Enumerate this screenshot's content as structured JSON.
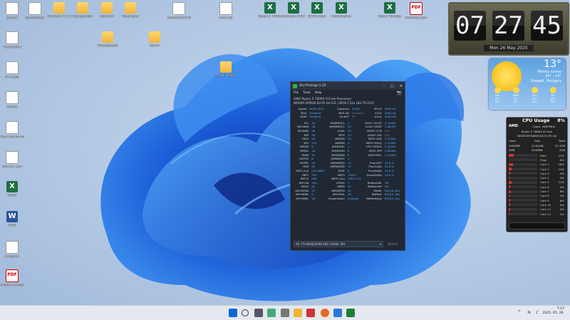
{
  "desktop_icons": [
    {
      "label": "Lomtár",
      "type": "txt"
    },
    {
      "label": "ZenTimings",
      "type": "txt"
    },
    {
      "label": "Windows 11 tweak fix",
      "type": "folder"
    },
    {
      "label": "Gyorsjavítás",
      "type": "folder"
    },
    {
      "label": "Macskák",
      "type": "folder"
    },
    {
      "label": "Fényképek",
      "type": "folder"
    },
    {
      "label": "XtremeShell DEP",
      "type": "txt"
    },
    {
      "label": "AMD.zip",
      "type": "txt"
    },
    {
      "label": "Ryzen 5 7600X",
      "type": "xls"
    },
    {
      "label": "Mérések 2025",
      "type": "xls"
    },
    {
      "label": "DDR5 teszt",
      "type": "xls"
    },
    {
      "label": "Hőmérséklet",
      "type": "xls"
    },
    {
      "label": "Ryzen Timings",
      "type": "xls"
    },
    {
      "label": "Kézikönyv.pdf",
      "type": "pdf"
    },
    {
      "label": "Fényképezés",
      "type": "folder"
    },
    {
      "label": "Zenék",
      "type": "folder"
    },
    {
      "label": "Asztal Mappa",
      "type": "folder"
    },
    {
      "label": "Vezérlőpult",
      "type": "txt"
    },
    {
      "label": "Ez a gép",
      "type": "txt"
    },
    {
      "label": "Firefox",
      "type": "txt"
    },
    {
      "label": "Total Commander",
      "type": "txt"
    },
    {
      "label": "MPC-HC x64",
      "type": "txt"
    },
    {
      "label": "Excel",
      "type": "xls"
    },
    {
      "label": "Word",
      "type": "docx"
    },
    {
      "label": "CCleaner",
      "type": "txt"
    },
    {
      "label": "Adobe Acrobat",
      "type": "pdf"
    }
  ],
  "zentimings": {
    "title": "ZenTimings 1.25",
    "menu": [
      "File",
      "Tools",
      "Help"
    ],
    "cpu_line1": "AMD Ryzen 5 7600X 6-Core Processor",
    "cpu_line2": "B650M AORUS ELITE AX ICE | BIOS F31a (84.79.225)",
    "top_rows": [
      [
        "Speed",
        "6000 MT/s",
        "Capacity",
        "32GB",
        "MCLK",
        "3000.00"
      ],
      [
        "BGS",
        "Enabled",
        "BGS Alt",
        "Disabled",
        "FCLK",
        "2000.00"
      ],
      [
        "GDM",
        "Enabled",
        "Cmd2T",
        "1T",
        "UCLK",
        "3000.00"
      ]
    ],
    "rows": [
      [
        "tCL",
        "30",
        "tRDRDSCL",
        "5",
        "VSOC (SVI3)",
        "1.2400V"
      ],
      [
        "tRCDWR",
        "36",
        "tWRWRSCL",
        "23",
        "CLDO VDDP",
        "1.0676V"
      ],
      [
        "tRCDRD",
        "36",
        "tCWL",
        "28",
        "VDDG CCD",
        "N/A"
      ],
      [
        "tRP",
        "36",
        "tRTP",
        "23",
        "VDDG IOD",
        "N/A"
      ],
      [
        "tRAS",
        "96",
        "tRDWR",
        "23",
        "MEM VDD",
        "1.2500V"
      ],
      [
        "tRC",
        "132",
        "tWRRD",
        "4",
        "MEM VDDQ",
        "1.2500V"
      ],
      [
        "tRRDS",
        "8",
        "tRDRDSC",
        "1",
        "CPU VDDIO",
        "1.2500V"
      ],
      [
        "tRRDL",
        "16",
        "tRDRDSD",
        "8",
        "MEM VPP",
        "1.8000V"
      ],
      [
        "tFAW",
        "32",
        "tRDRDDD",
        "8",
        "VDD MISC",
        "1.1000V"
      ],
      [
        "tWTRS",
        "6",
        "tWRWRSC",
        "1",
        "",
        ""
      ],
      [
        "tWTRL",
        "30",
        "tWRWRSD",
        "15",
        "ProcODT",
        "43.6 Ω"
      ],
      [
        "tWR",
        "90",
        "tWRWRDD",
        "15",
        "ProcCaDs",
        "32.0 Ω"
      ],
      [
        "tRFC (ns)",
        "234.6667",
        "tCKE",
        "0",
        "ProcDqDs",
        "34.0 Ω"
      ],
      [
        "tRFC",
        "704",
        "tREFI",
        "11617",
        "DramDqDs",
        "34.0 Ω"
      ],
      [
        "tRFC2",
        "480",
        "tREFI (ns)",
        "3882.333",
        "",
        ""
      ],
      [
        "tRFCsb",
        "390",
        "tSTAG",
        "7",
        "RttNomWr",
        "Off"
      ],
      [
        "tMOD",
        "42",
        "tMRD",
        "42",
        "RttNomRd",
        "Off"
      ],
      [
        "tMODPDA",
        "32",
        "tMRDPDA",
        "32",
        "RttWr",
        "RZQ/6 (40)"
      ],
      [
        "tPHYWRD",
        "6",
        "tPHYRDL",
        "36",
        "RttPark",
        "RZQ/5 (48)"
      ],
      [
        "tPHYWRL",
        "16",
        "PowerDown",
        "Enabled",
        "RttParkDqs",
        "RZQ/6 (40)"
      ]
    ],
    "dimm": "A2: F5-6000J3036F16G (16GB, SR)",
    "debug": "DEBUG"
  },
  "clock": {
    "h": "07",
    "m": "27",
    "s": "45",
    "date": "Mon 26 May 2025"
  },
  "weather": {
    "temp": "13°",
    "cond1": "Mostly sunny",
    "cond2": "24° - 14°",
    "location": "Szeged, Hungary",
    "forecast": [
      {
        "day": "Tue",
        "hi": "28°",
        "lo": "14°"
      },
      {
        "day": "Wed",
        "hi": "27°",
        "lo": "15°"
      },
      {
        "day": "Thu",
        "hi": "26°",
        "lo": "16°"
      },
      {
        "day": "Fri",
        "hi": "24°",
        "lo": "16°"
      }
    ]
  },
  "cpu_gadget": {
    "title": "CPU Usage",
    "percent": "8%",
    "brand": "AMD",
    "clock": "Clock: 3697MHz",
    "name": "Ryzen 5 7600X 6-Core",
    "host": "DESKTOP-RA65CS8 ELITE AX",
    "headers": [
      "Used",
      "Free",
      "Total"
    ],
    "mem_rows": [
      [
        "5405MB",
        "25.84GB",
        "31.1GB"
      ],
      [
        "0MB",
        "2048MB",
        "2GB"
      ]
    ],
    "cores": [
      {
        "label": "RAM",
        "val": "17%",
        "fill": 0.17
      },
      {
        "label": "Page",
        "val": "0%",
        "fill": 0.0
      },
      {
        "label": "Core 1",
        "val": "16%",
        "fill": 0.16
      },
      {
        "label": "Core 2",
        "val": "11%",
        "fill": 0.11
      },
      {
        "label": "Core 3",
        "val": "5%",
        "fill": 0.05
      },
      {
        "label": "Core 4",
        "val": "2%",
        "fill": 0.02
      },
      {
        "label": "Core 5",
        "val": "11%",
        "fill": 0.11
      },
      {
        "label": "Core 6",
        "val": "4%",
        "fill": 0.04
      },
      {
        "label": "Core 7",
        "val": "8%",
        "fill": 0.08
      },
      {
        "label": "Core 8",
        "val": "2%",
        "fill": 0.02
      },
      {
        "label": "Core 9",
        "val": "6%",
        "fill": 0.06
      },
      {
        "label": "Core 10",
        "val": "4%",
        "fill": 0.04
      },
      {
        "label": "Core 11",
        "val": "4%",
        "fill": 0.04
      },
      {
        "label": "Core 12",
        "val": "2%",
        "fill": 0.02
      }
    ]
  },
  "taskbar": {
    "time": "7:27",
    "date": "2025. 05. 26."
  }
}
